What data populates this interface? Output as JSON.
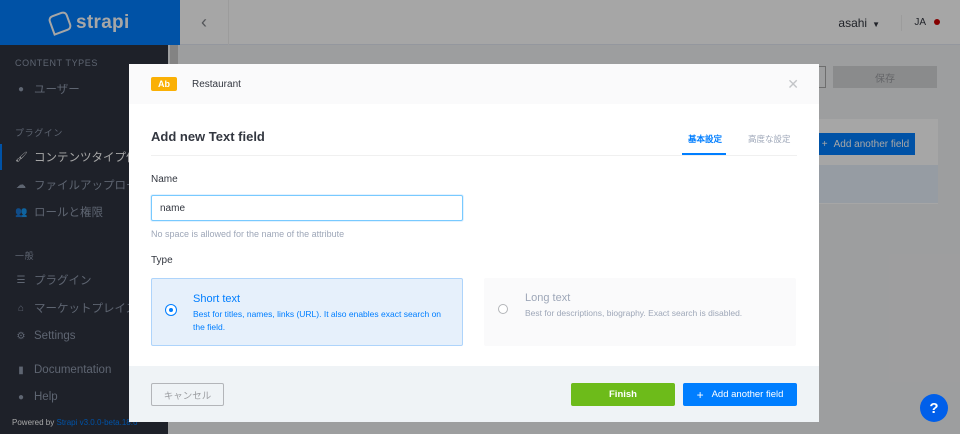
{
  "app": {
    "brand": "strapi"
  },
  "sidebar": {
    "sections": [
      {
        "title": "CONTENT TYPES"
      },
      {
        "title": "プラグイン"
      },
      {
        "title": "一般"
      }
    ],
    "content_types": [
      {
        "label": "ユーザー",
        "icon": "bullet-icon"
      }
    ],
    "plugins": [
      {
        "label": "コンテンツタイプ作成",
        "icon": "paint-brush-icon",
        "active": true
      },
      {
        "label": "ファイルアップロード",
        "icon": "cloud-upload-icon"
      },
      {
        "label": "ロールと権限",
        "icon": "users-icon"
      }
    ],
    "general": [
      {
        "label": "プラグイン",
        "icon": "list-icon"
      },
      {
        "label": "マーケットプレイス",
        "icon": "shop-icon"
      },
      {
        "label": "Settings",
        "icon": "gear-icon"
      }
    ],
    "bottom": [
      {
        "label": "Documentation",
        "icon": "book-icon"
      },
      {
        "label": "Help",
        "icon": "question-icon"
      }
    ],
    "powered_prefix": "Powered by",
    "powered_link": "Strapi v3.0.0-beta.18.6"
  },
  "topbar": {
    "username": "asahi",
    "lang": "JA"
  },
  "background": {
    "save_label": "保存",
    "add_field_label": "Add another field"
  },
  "modal": {
    "badge": "Ab",
    "content_type": "Restaurant",
    "title": "Add new Text field",
    "tabs": [
      {
        "label": "基本設定",
        "active": true
      },
      {
        "label": "高度な設定",
        "active": false
      }
    ],
    "name_label": "Name",
    "name_value": "name",
    "name_hint": "No space is allowed for the name of the attribute",
    "type_label": "Type",
    "types": [
      {
        "title": "Short text",
        "description": "Best for titles, names, links (URL). It also enables exact search on the field.",
        "selected": true
      },
      {
        "title": "Long text",
        "description": "Best for descriptions, biography. Exact search is disabled.",
        "selected": false
      }
    ],
    "cancel_label": "キャンセル",
    "finish_label": "Finish",
    "add_field_label": "Add another field"
  },
  "colors": {
    "primary": "#007eff",
    "finish": "#6dbb1a",
    "badge": "#fab005",
    "sidebar": "#2e3340"
  }
}
